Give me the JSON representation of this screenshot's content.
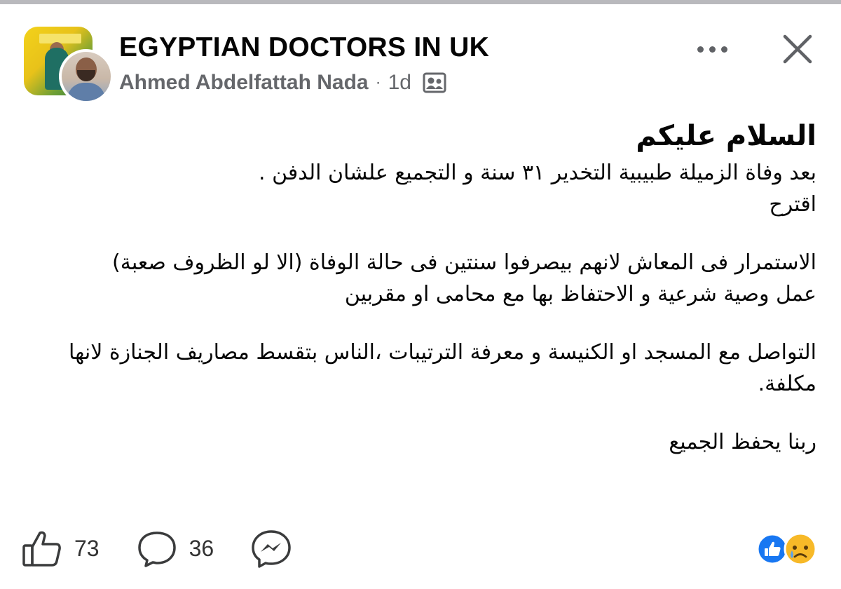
{
  "post": {
    "group_name": "EGYPTIAN DOCTORS IN UK",
    "author": "Ahmed Abdelfattah Nada",
    "separator": "·",
    "time": "1d",
    "audience_icon": "group-members-icon",
    "greeting": "السلام عليكم",
    "paragraphs": [
      "بعد وفاة الزميلة طبيبية التخدير ٣١ سنة و التجميع علشان الدفن .",
      "اقترح",
      "",
      "الاستمرار فى المعاش لانهم بيصرفوا سنتين فى حالة الوفاة (الا لو الظروف صعبة)",
      "عمل وصية شرعية و الاحتفاظ بها مع محامى او مقربين",
      "",
      "التواصل مع المسجد او الكنيسة و معرفة الترتيبات ،الناس بتقسط مصاريف الجنازة لانها مكلفة.",
      "",
      "ربنا يحفظ الجميع"
    ]
  },
  "actions": {
    "like_count": "73",
    "comment_count": "36",
    "like_icon": "thumbs-up-icon",
    "comment_icon": "comment-bubble-icon",
    "share_icon": "messenger-icon"
  },
  "reactions": [
    "like",
    "sad"
  ],
  "colors": {
    "text": "#050505",
    "secondary": "#65676b",
    "like_blue": "#1877f2",
    "sad_yellow": "#f7b928"
  }
}
